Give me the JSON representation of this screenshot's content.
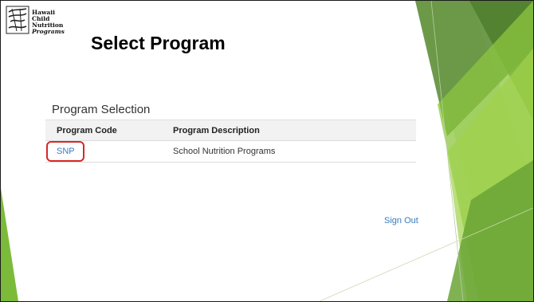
{
  "logo": {
    "lines": [
      "Hawaii",
      "Child",
      "Nutrition",
      "Programs"
    ]
  },
  "page": {
    "title": "Select Program"
  },
  "program_selection": {
    "heading": "Program Selection",
    "columns": [
      "Program Code",
      "Program Description"
    ],
    "rows": [
      {
        "code": "SNP",
        "description": "School Nutrition Programs"
      }
    ]
  },
  "actions": {
    "sign_out": "Sign Out"
  },
  "colors": {
    "link": "#3a7bbf",
    "highlight": "#d62828",
    "deco_green_dark": "#5a8f2e",
    "deco_green_light": "#8cc63f"
  }
}
